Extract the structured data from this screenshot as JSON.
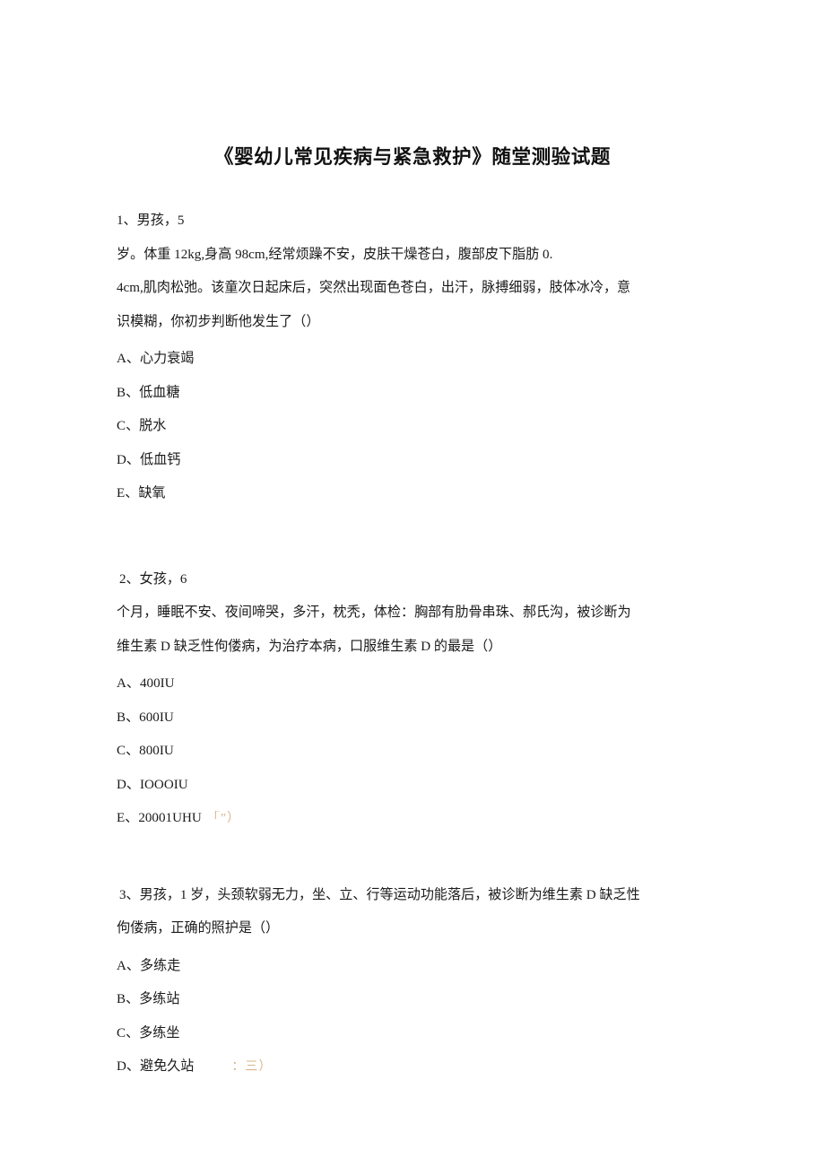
{
  "document": {
    "title": "《婴幼儿常见疾病与紧急救护》随堂测验试题",
    "questions": [
      {
        "number": "1、",
        "stem_line1": "1、男孩，5",
        "stem_line2": "岁。体重 12kg,身高 98cm,经常烦躁不安，皮肤干燥苍白，腹部皮下脂肪 0.",
        "stem_line3": "4cm,肌肉松弛。该童次日起床后，突然出现面色苍白，出汗，脉搏细弱，肢体冰冷，意",
        "stem_line4": "识模糊，你初步判断他发生了（）",
        "options": [
          {
            "label": "A、",
            "text": "心力衰竭",
            "artifact": ""
          },
          {
            "label": "B、",
            "text": "低血糖",
            "artifact": ""
          },
          {
            "label": "C、",
            "text": "脱水",
            "artifact": ""
          },
          {
            "label": "D、",
            "text": "低血钙",
            "artifact": ""
          },
          {
            "label": "E、",
            "text": "缺氧",
            "artifact": ""
          }
        ]
      },
      {
        "number": "2、",
        "stem_line1": "2、女孩，6",
        "stem_line2": "个月，睡眠不安、夜间啼哭，多汗，枕秃，体检：胸部有肋骨串珠、郝氏沟，被诊断为",
        "stem_line3": "维生素 D 缺乏性佝偻病，为治疗本病，口服维生素 D 的最是（）",
        "options": [
          {
            "label": "A、",
            "text": "400IU",
            "artifact": ""
          },
          {
            "label": "B、",
            "text": "600IU",
            "artifact": ""
          },
          {
            "label": "C、",
            "text": "800IU",
            "artifact": ""
          },
          {
            "label": "D、",
            "text": "IOOOIU",
            "artifact": ""
          },
          {
            "label": "E、",
            "text": "20001UHU",
            "artifact": "「”）"
          }
        ]
      },
      {
        "number": "3、",
        "stem_line1": "3、男孩，1 岁，头颈软弱无力，坐、立、行等运动功能落后，被诊断为维生素 D 缺乏性",
        "stem_line2": "佝偻病，正确的照护是（）",
        "options": [
          {
            "label": "A、",
            "text": "多练走",
            "artifact": ""
          },
          {
            "label": "B、",
            "text": "多练站",
            "artifact": ""
          },
          {
            "label": "C、",
            "text": "多练坐",
            "artifact": ""
          },
          {
            "label": "D、",
            "text": "避免久站",
            "artifact": "：三）"
          }
        ]
      }
    ]
  },
  "colors": {
    "page_background": "#ffffff",
    "text": "#1a1a1a",
    "artifact": "#d3a876"
  }
}
